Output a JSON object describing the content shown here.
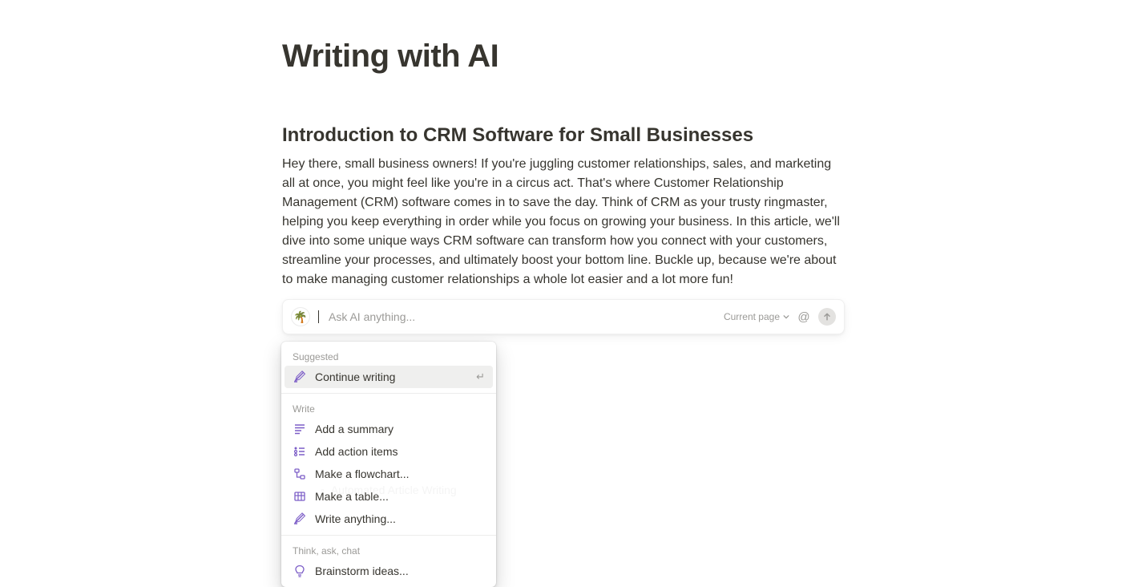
{
  "page": {
    "title": "Writing with AI",
    "sectionHeading": "Introduction to CRM Software for Small Businesses",
    "bodyParagraph": "Hey there, small business owners! If you're juggling customer relationships, sales, and marketing all at once, you might feel like you're in a circus act. That's where Customer Relationship Management (CRM) software comes in to save the day. Think of CRM as your trusty ringmaster, helping you keep everything in order while you focus on growing your business. In this article, we'll dive into some unique ways CRM software can transform how you connect with your customers, streamline your processes, and ultimately boost your bottom line. Buckle up, because we're about to make managing customer relationships a whole lot easier and a lot more fun!"
  },
  "aiBar": {
    "avatarEmoji": "🌴",
    "placeholder": "Ask AI anything...",
    "scope": "Current page"
  },
  "dropdown": {
    "sections": [
      {
        "label": "Suggested",
        "items": [
          {
            "icon": "pencil",
            "label": "Continue writing",
            "highlighted": true,
            "showEnter": true
          }
        ]
      },
      {
        "label": "Write",
        "items": [
          {
            "icon": "summary",
            "label": "Add a summary"
          },
          {
            "icon": "checklist",
            "label": "Add action items"
          },
          {
            "icon": "flowchart",
            "label": "Make a flowchart..."
          },
          {
            "icon": "table",
            "label": "Make a table..."
          },
          {
            "icon": "pencil",
            "label": "Write anything..."
          }
        ]
      },
      {
        "label": "Think, ask, chat",
        "items": [
          {
            "icon": "lightbulb",
            "label": "Brainstorm ideas..."
          }
        ]
      }
    ]
  },
  "hiddenBelow": {
    "line": "Automated Article Writing"
  }
}
